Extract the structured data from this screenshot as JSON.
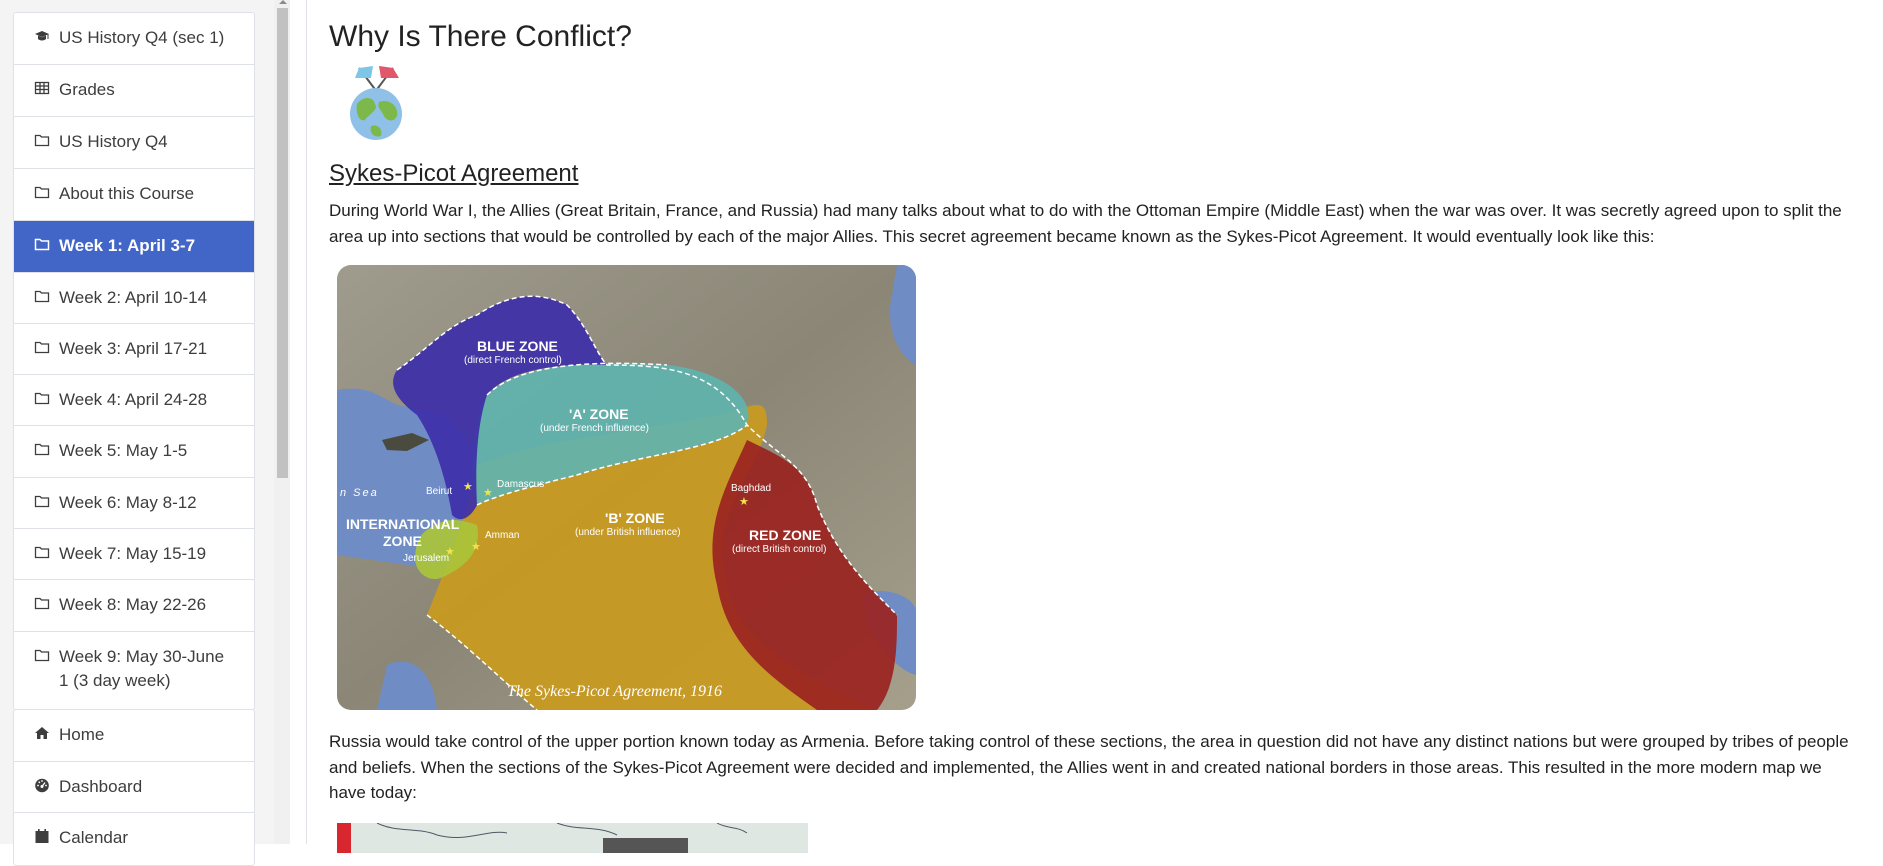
{
  "nav_top": [
    {
      "label": "US History Q4 (sec 1)",
      "icon": "graduation-cap-icon"
    },
    {
      "label": "Grades",
      "icon": "table-icon"
    },
    {
      "label": "US History Q4",
      "icon": "folder-icon"
    },
    {
      "label": "About this Course",
      "icon": "folder-icon"
    },
    {
      "label": "Week 1: April 3-7",
      "icon": "folder-icon",
      "active": true
    },
    {
      "label": "Week 2: April 10-14",
      "icon": "folder-icon"
    },
    {
      "label": "Week 3: April 17-21",
      "icon": "folder-icon"
    },
    {
      "label": "Week 4: April 24-28",
      "icon": "folder-icon"
    },
    {
      "label": "Week 5: May 1-5",
      "icon": "folder-icon"
    },
    {
      "label": "Week 6: May 8-12",
      "icon": "folder-icon"
    },
    {
      "label": "Week 7: May 15-19",
      "icon": "folder-icon"
    },
    {
      "label": "Week 8: May 22-26",
      "icon": "folder-icon"
    },
    {
      "label": "Week 9: May 30-June 1 (3 day week)",
      "icon": "folder-icon"
    }
  ],
  "nav_bottom": [
    {
      "label": "Home",
      "icon": "home-icon"
    },
    {
      "label": "Dashboard",
      "icon": "dashboard-icon"
    },
    {
      "label": "Calendar",
      "icon": "calendar-icon"
    }
  ],
  "content": {
    "title": "Why Is There Conflict?",
    "section_title": "Sykes-Picot Agreement",
    "paragraph1": "During World War I, the Allies (Great Britain, France, and Russia) had many talks about what to do with the Ottoman Empire (Middle East) when the war was over. It was secretly agreed upon to split the area up into sections that would be controlled by each of the major Allies. This secret agreement became known as the Sykes-Picot Agreement. It would eventually look like this:",
    "paragraph2": "Russia would take control of the upper portion known today as Armenia. Before taking control of these sections, the area in question did not have any distinct nations but were grouped by tribes of people and beliefs. When the sections of the Sykes-Picot Agreement were decided and implemented, the Allies went in and created national borders in those areas. This resulted in the more modern map we have today:"
  },
  "map": {
    "caption": "The Sykes-Picot Agreement, 1916",
    "blue_zone": "BLUE ZONE",
    "blue_zone_sub": "(direct French control)",
    "a_zone": "'A' ZONE",
    "a_zone_sub": "(under French influence)",
    "b_zone": "'B' ZONE",
    "b_zone_sub": "(under British influence)",
    "red_zone": "RED ZONE",
    "red_zone_sub": "(direct British control)",
    "intl_zone_1": "INTERNATIONAL",
    "intl_zone_2": "ZONE",
    "sea": "n  Sea",
    "cities": {
      "beirut": "Beirut",
      "damascus": "Damascus",
      "amman": "Amman",
      "jerusalem": "Jerusalem",
      "baghdad": "Baghdad"
    }
  },
  "colors": {
    "accent": "#4266c8",
    "blue_zone": "#3d2fa8",
    "a_zone": "#5fb3ae",
    "b_zone": "#c99a1e",
    "red_zone": "#9a2320",
    "intl_zone": "#a9c43a"
  }
}
